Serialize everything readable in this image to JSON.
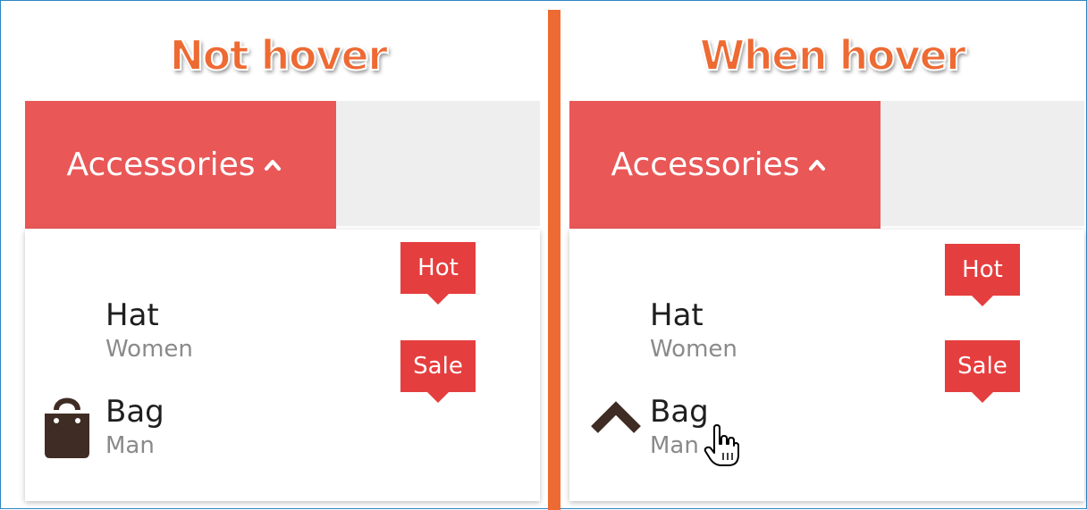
{
  "left": {
    "heading": "Not hover",
    "menu": {
      "label": "Accessories"
    },
    "items": [
      {
        "title": "Hat",
        "subtitle": "Women",
        "badge": "Hot"
      },
      {
        "title": "Bag",
        "subtitle": "Man",
        "badge": "Sale",
        "icon": "shopping-bag-icon"
      }
    ]
  },
  "right": {
    "heading": "When hover",
    "menu": {
      "label": "Accessories"
    },
    "items": [
      {
        "title": "Hat",
        "subtitle": "Women",
        "badge": "Hot"
      },
      {
        "title": "Bag",
        "subtitle": "Man",
        "badge": "Sale",
        "icon": "chevron-up-icon"
      }
    ]
  },
  "colors": {
    "accent": "#e95757",
    "badge": "#e53e3e",
    "heading": "#ee6a33",
    "divider": "#ee6a33",
    "border": "#2f84c4"
  }
}
